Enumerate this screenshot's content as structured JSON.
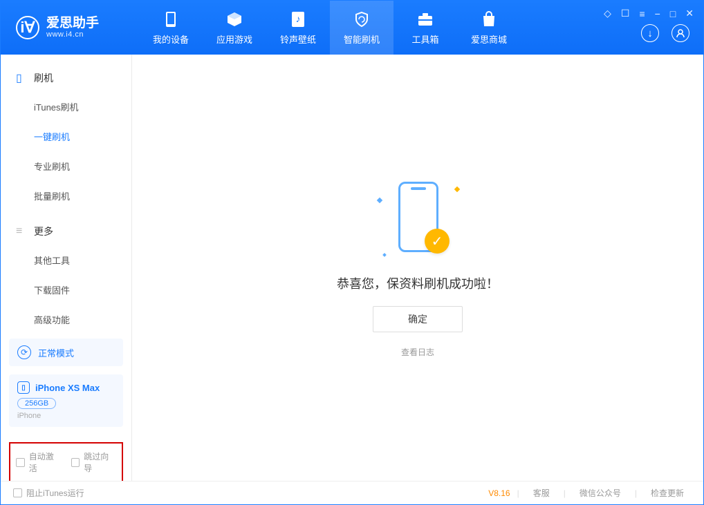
{
  "app": {
    "title": "爱思助手",
    "subtitle": "www.i4.cn"
  },
  "nav": [
    {
      "label": "我的设备"
    },
    {
      "label": "应用游戏"
    },
    {
      "label": "铃声壁纸"
    },
    {
      "label": "智能刷机"
    },
    {
      "label": "工具箱"
    },
    {
      "label": "爱思商城"
    }
  ],
  "sidebar": {
    "section1_title": "刷机",
    "section1_items": [
      "iTunes刷机",
      "一键刷机",
      "专业刷机",
      "批量刷机"
    ],
    "section2_title": "更多",
    "section2_items": [
      "其他工具",
      "下载固件",
      "高级功能"
    ],
    "mode_label": "正常模式",
    "device_name": "iPhone XS Max",
    "device_storage": "256GB",
    "device_type": "iPhone",
    "chk_auto_activate": "自动激活",
    "chk_skip_guide": "跳过向导"
  },
  "main": {
    "success_msg": "恭喜您，保资料刷机成功啦！",
    "confirm_btn": "确定",
    "log_link": "查看日志"
  },
  "footer": {
    "chk_block_itunes": "阻止iTunes运行",
    "version": "V8.16",
    "link_service": "客服",
    "link_wechat": "微信公众号",
    "link_update": "检查更新"
  }
}
